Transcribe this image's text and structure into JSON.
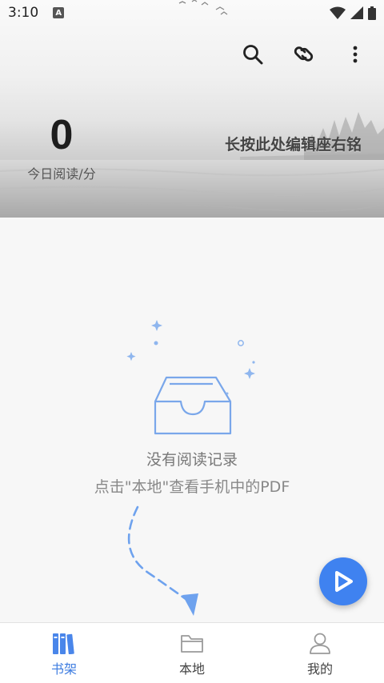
{
  "status_bar": {
    "time": "3:10",
    "notification_icon": "A"
  },
  "toolbar": {
    "search_icon": "search-icon",
    "link_icon": "link-icon",
    "more_icon": "more-vert-icon"
  },
  "header": {
    "today_reading_value": "0",
    "today_reading_label": "今日阅读/分",
    "motto": "长按此处编辑座右铭"
  },
  "empty_state": {
    "title": "没有阅读记录",
    "hint": "点击\"本地\"查看手机中的PDF"
  },
  "bottom_nav": {
    "items": [
      {
        "label": "书架",
        "icon": "bookshelf-icon",
        "active": true
      },
      {
        "label": "本地",
        "icon": "folder-icon",
        "active": false
      },
      {
        "label": "我的",
        "icon": "profile-icon",
        "active": false
      }
    ]
  },
  "colors": {
    "accent": "#3f82f0",
    "active_tab": "#3d7ce0",
    "illustration": "#8fb6ee"
  }
}
